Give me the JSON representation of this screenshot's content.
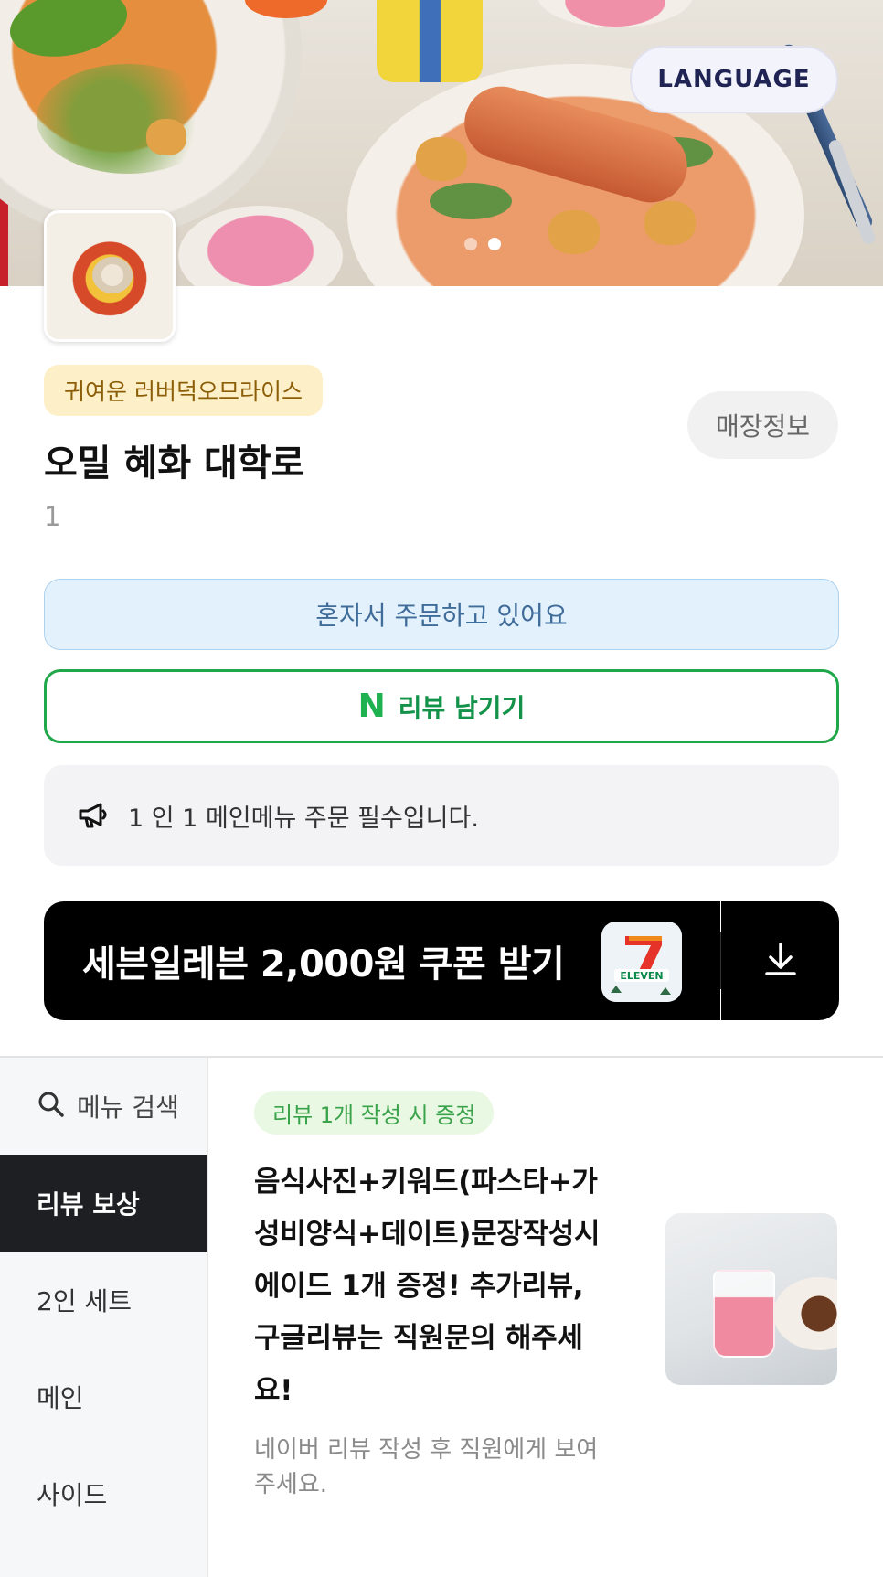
{
  "hero": {
    "language_button": "LANGUAGE",
    "carousel": {
      "total": 2,
      "active_index": 1
    }
  },
  "store": {
    "category": "귀여운 러버덕오므라이스",
    "name": "오밀 혜화 대학로",
    "table_number": "1",
    "info_button": "매장정보"
  },
  "actions": {
    "solo_order": "혼자서 주문하고 있어요",
    "review_icon_letter": "N",
    "review_button": "리뷰 남기기"
  },
  "notice": {
    "text": "1 인 1 메인메뉴 주문 필수입니다.",
    "icon": "megaphone-icon"
  },
  "coupon": {
    "text": "세븐일레븐 2,000원 쿠폰 받기",
    "logo_text": "ELEVEN",
    "icon": "download-icon"
  },
  "sidebar": {
    "search_label": "메뉴 검색",
    "items": [
      {
        "label": "리뷰 보상",
        "active": true
      },
      {
        "label": "2인 세트",
        "active": false
      },
      {
        "label": "메인",
        "active": false
      },
      {
        "label": "사이드",
        "active": false
      }
    ]
  },
  "menu_item": {
    "badge": "리뷰 1개 작성 시 증정",
    "title": "음식사진+키워드(파스타+가성비양식+데이트)문장작성시 에이드 1개 증정! 추가리뷰, 구글리뷰는 직원문의 해주세요!",
    "description": "네이버 리뷰 작성 후 직원에게 보여주세요."
  },
  "colors": {
    "accent_green": "#1fa74a",
    "solo_bg": "#e3f1fc",
    "category_bg": "#fdf0c8",
    "active_sidebar": "#1e1f22",
    "coupon_bg": "#000000"
  }
}
